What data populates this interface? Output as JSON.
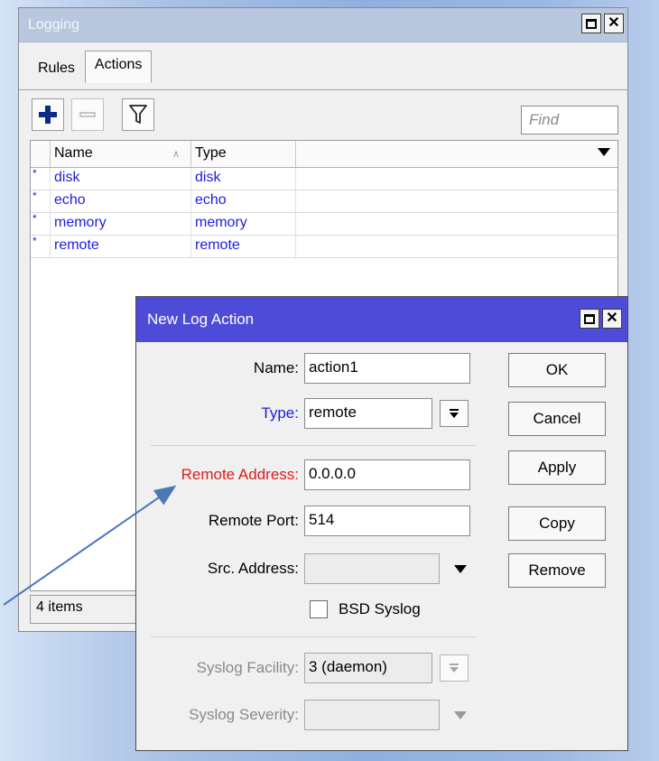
{
  "logging_window": {
    "title": "Logging",
    "tabs": [
      {
        "label": "Rules"
      },
      {
        "label": "Actions"
      }
    ],
    "find_placeholder": "Find",
    "columns": {
      "name": "Name",
      "type": "Type"
    },
    "rows": [
      {
        "name": "disk",
        "type": "disk"
      },
      {
        "name": "echo",
        "type": "echo"
      },
      {
        "name": "memory",
        "type": "memory"
      },
      {
        "name": "remote",
        "type": "remote"
      }
    ],
    "status": "4 items",
    "colors": {
      "row_text": "#1d1de0"
    }
  },
  "dialog": {
    "title": "New Log Action",
    "fields": {
      "name": {
        "label": "Name:",
        "value": "action1"
      },
      "type": {
        "label": "Type:",
        "value": "remote"
      },
      "remote_address": {
        "label": "Remote Address:",
        "value": "0.0.0.0"
      },
      "remote_port": {
        "label": "Remote Port:",
        "value": "514"
      },
      "src_address": {
        "label": "Src. Address:",
        "value": ""
      },
      "bsd_syslog": {
        "label": "BSD Syslog",
        "checked": false
      },
      "syslog_facility": {
        "label": "Syslog Facility:",
        "value": "3 (daemon)"
      },
      "syslog_severity": {
        "label": "Syslog Severity:",
        "value": ""
      }
    },
    "buttons": {
      "ok": "OK",
      "cancel": "Cancel",
      "apply": "Apply",
      "copy": "Copy",
      "remove": "Remove"
    },
    "colors": {
      "titlebar": "#4e4bd9",
      "required_label": "#e01b1b",
      "type_label": "#1c1cd6"
    }
  },
  "icons": [
    "plus-icon",
    "minus-icon",
    "filter-icon",
    "maximize-icon",
    "close-icon",
    "chevron-down-icon",
    "sort-asc-icon"
  ]
}
